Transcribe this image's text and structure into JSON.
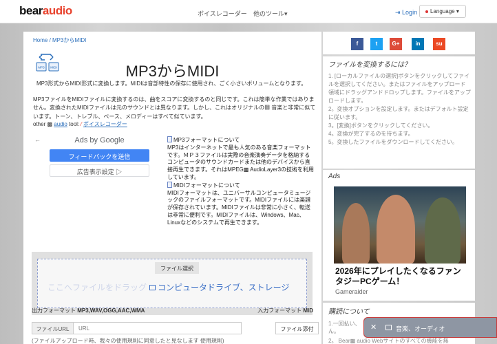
{
  "nav": {
    "logo_bear": "bear",
    "logo_audio": "audio",
    "voice_recorder": "ボイスレコーダー",
    "other_tools": "他のツール▾",
    "login": "Login",
    "language": "Language ▾"
  },
  "breadcrumb": "Home / MP3からMIDI",
  "icon_labels": {
    "from": "MP3",
    "to": "MIDI"
  },
  "title": "MP3からMIDI",
  "subtitle": "MP3形式からMIDI形式に変換します。MIDIは音部特性の保存に使用され、ごく小さいボリュームとなります。",
  "description": "MP3ファイルをMIDIファイルに変換するのは、曲をスコアに変換するのと同じです。これは簡単な作業ではありません。変換されたMIDIファイルは元のサウンドとは異なります。しかし、これはオリジナルの▩ 音楽と非常に似ています。トーン、トレブル、ベース、メロディーはすべて似ています。",
  "other_tool": {
    "prefix": "other ▩",
    "audio": "audio",
    "tool": "tool:",
    "link": "ボイスレコーダー"
  },
  "ad_left": {
    "arrow": "←",
    "ads_by": "Ads by Google",
    "feedback": "フィードバックを送信",
    "settings": "広告表示設定 ▷"
  },
  "formats": {
    "mp3_heading": "MP3フォーマットについて",
    "mp3_text": "MP3はインターネットで最も人気のある音楽フォーマットです。ＭＰ３ファイルは実際の音楽演奏データを格納するコンピュータのサウンドカードまたは他のデバイスから直接再生できます。それはMPEG▩ AudioLayer3の技術を利用しています。",
    "midi_heading": "MIDIフォーマットについて",
    "midi_text": "MIDIフォーマットは、ユニバーサルコンピュータミュージックのファイルフォーマットです。MIDIファイルには楽譜が保存されています。MIDIファイルは非常に小さく、転送は非常に便利です。MIDIファイルは、Windows、Mac、Linuxなどのシステムで再生できます。"
  },
  "upload": {
    "file_select": "ファイル選択",
    "drop_hint": "ここへファイルをドラッグ",
    "drop_sources": "コンピュータドライブ、ストレージ"
  },
  "output_format": {
    "label": "出力フォーマット",
    "value": "MP3,WAV,OGG,AAC,WMA"
  },
  "input_format": {
    "label": "入力フォーマット",
    "value": "MID"
  },
  "url": {
    "label": "ファイルURL",
    "placeholder": "URL"
  },
  "attach": "ファイル添付",
  "notice": "(ファイルアップロード時、我々の使用規則に同意したと見なします 使用規則)",
  "social": [
    {
      "icon": "f",
      "color": "#3b5998"
    },
    {
      "icon": "t",
      "color": "#1da1f2"
    },
    {
      "icon": "G+",
      "color": "#dd4b39"
    },
    {
      "icon": "in",
      "color": "#0077b5"
    },
    {
      "icon": "su",
      "color": "#eb4924"
    }
  ],
  "how": {
    "heading": "ファイルを変換するには？",
    "steps": [
      "1. [ローカルファイルの選択]ボタンをクリックしてファイルを選択してください。またはファイルをアップロード領域にドラッグアンドドロップします。ファイルをアップロードします。",
      "2。変換オプションを設定します。またはデフォルト設定に従います。",
      "3。[変換]ボタンをクリックしてください。",
      "4。変換が完了するのを待ちます。",
      "5。変換したファイルをダウンロードしてください。"
    ]
  },
  "ads_right": {
    "heading": "Ads",
    "headline": "2026年にプレイしたくなるファンタジーPCゲーム！",
    "source": "Gameraider"
  },
  "about": {
    "heading": "購読について",
    "line1": "1.一回払い、",
    "line2": "ん。",
    "line3": "2。 Bear▩ audio Webサイトのすべての機能を無"
  },
  "toast": {
    "close": "✕",
    "text": "音楽、オーディオ"
  }
}
